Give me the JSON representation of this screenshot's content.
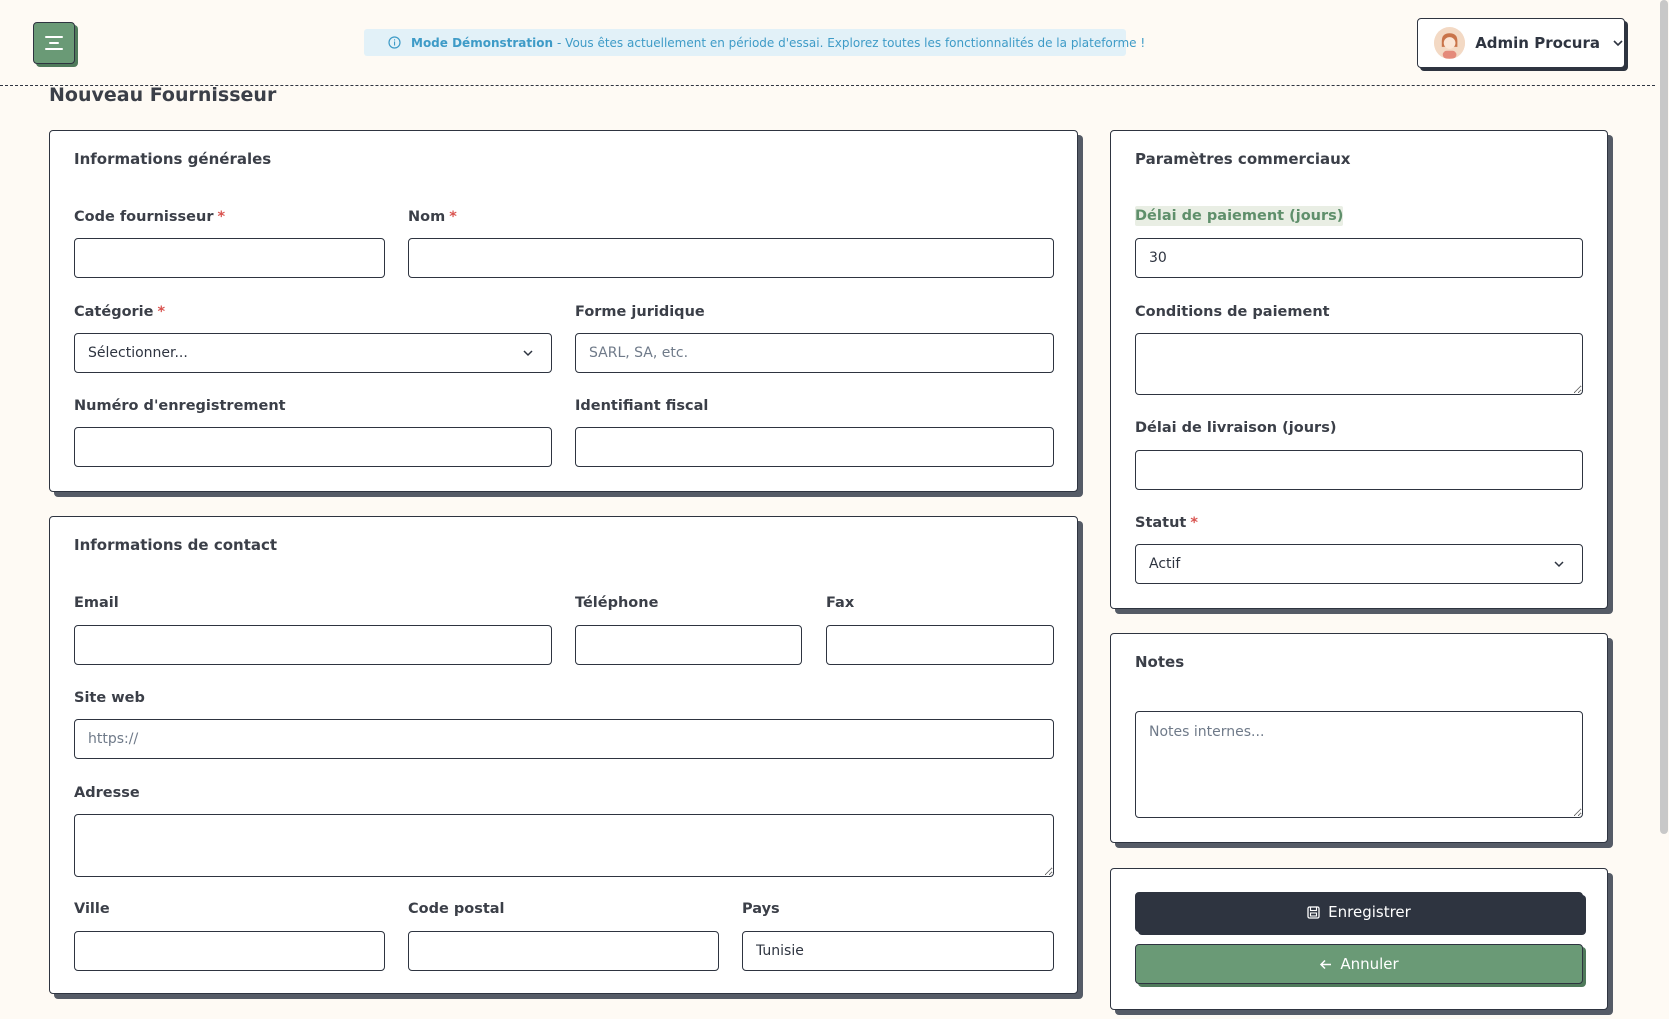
{
  "header": {
    "demo_title": "Mode Démonstration",
    "demo_text": "- Vous êtes actuellement en période d'essai. Explorez toutes les fonctionnalités de la plateforme !",
    "user_name": "Admin Procura"
  },
  "page": {
    "title": "Nouveau Fournisseur"
  },
  "general": {
    "title": "Informations générales",
    "code_label": "Code fournisseur",
    "name_label": "Nom",
    "category_label": "Catégorie",
    "category_value": "Sélectionner...",
    "legal_form_label": "Forme juridique",
    "legal_form_placeholder": "SARL, SA, etc.",
    "registration_label": "Numéro d'enregistrement",
    "tax_id_label": "Identifiant fiscal",
    "required_mark": "*"
  },
  "contact": {
    "title": "Informations de contact",
    "email_label": "Email",
    "phone_label": "Téléphone",
    "fax_label": "Fax",
    "website_label": "Site web",
    "website_placeholder": "https://",
    "address_label": "Adresse",
    "city_label": "Ville",
    "postal_label": "Code postal",
    "country_label": "Pays",
    "country_value": "Tunisie"
  },
  "commercial": {
    "title": "Paramètres commerciaux",
    "payment_delay_label": "Délai de paiement (jours)",
    "payment_delay_value": "30",
    "payment_terms_label": "Conditions de paiement",
    "delivery_delay_label": "Délai de livraison (jours)",
    "status_label": "Statut",
    "status_value": "Actif"
  },
  "notes": {
    "title": "Notes",
    "placeholder": "Notes internes..."
  },
  "actions": {
    "save_label": "Enregistrer",
    "cancel_label": "Annuler"
  },
  "colors": {
    "accent_green": "#6a9a76",
    "dark": "#2e3440",
    "banner_bg": "#e2f1f8",
    "banner_text": "#3e9bc7",
    "required": "#d9534f"
  }
}
